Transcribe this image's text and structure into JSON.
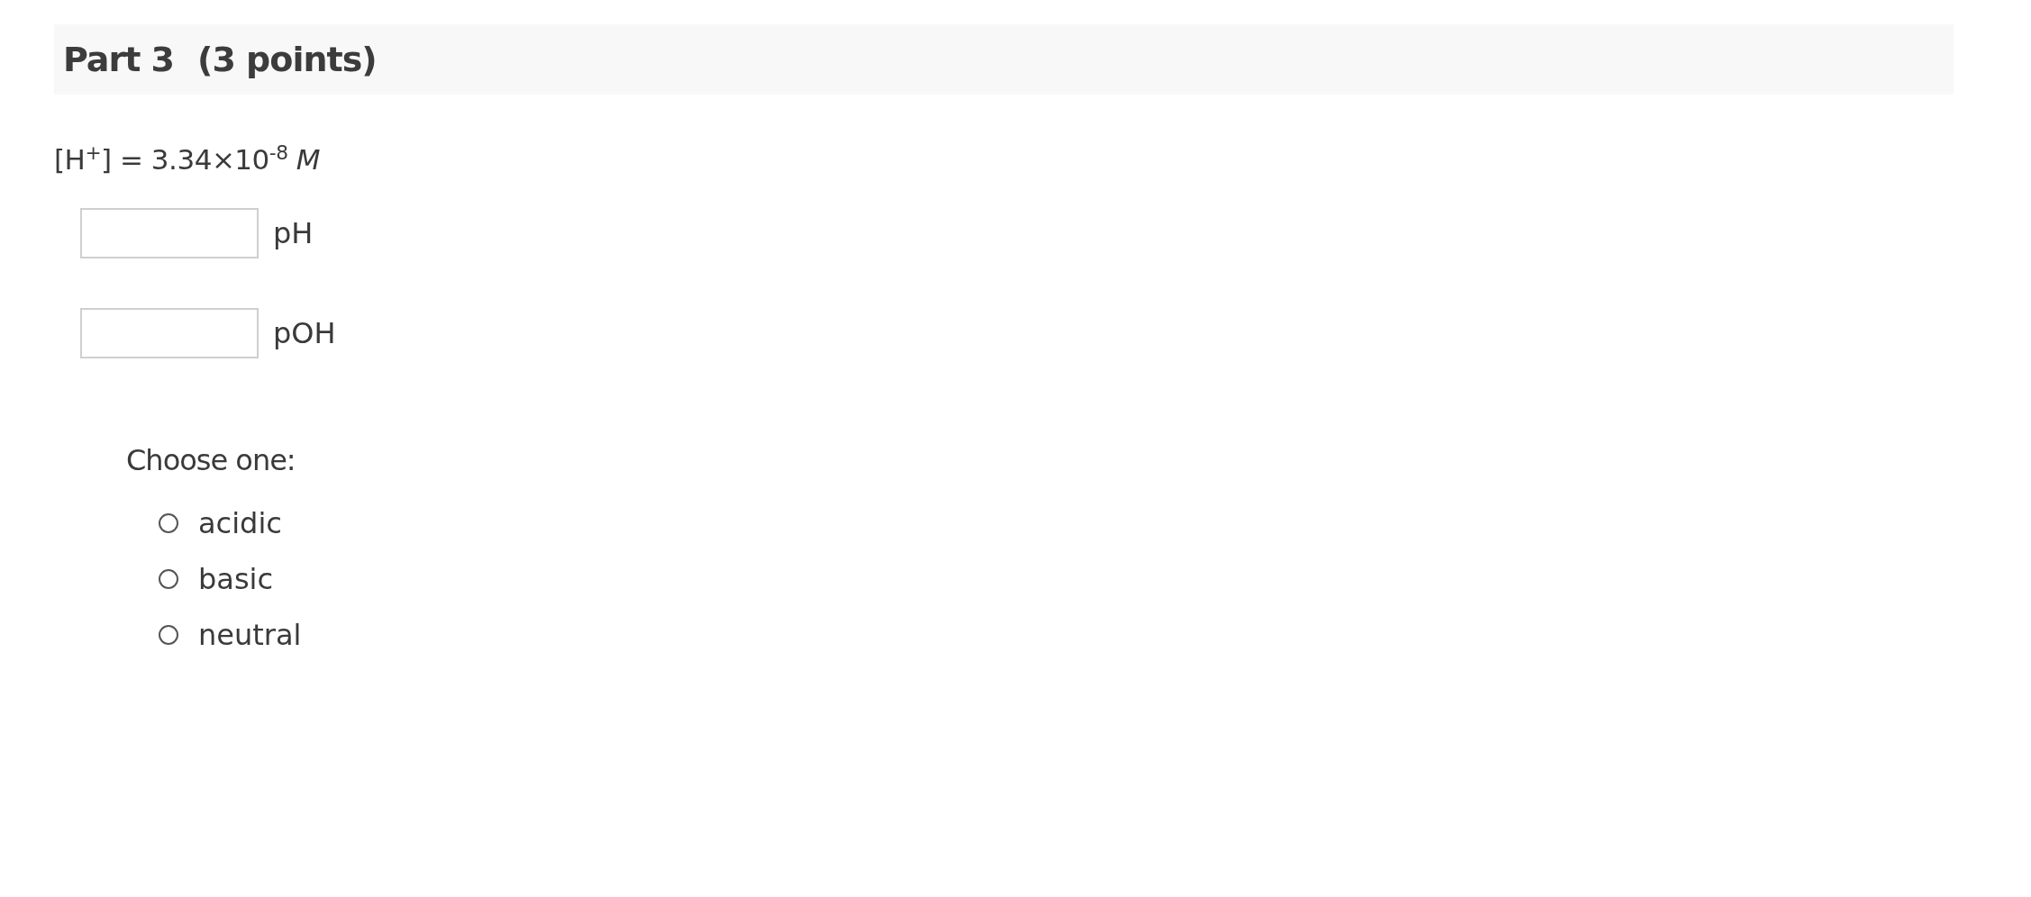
{
  "part": {
    "title": "Part 3",
    "points": "(3 points)"
  },
  "question": "[H$^{+}$] = 3.34×10$^{-8}$ *M*",
  "answers": [
    {
      "label": "pH"
    },
    {
      "label": "pOH"
    }
  ],
  "choice_prompt": "Choose one:",
  "choices": [
    {
      "label": "acidic",
      "selected": false
    },
    {
      "label": "basic",
      "selected": false
    },
    {
      "label": "neutral",
      "selected": false
    }
  ]
}
